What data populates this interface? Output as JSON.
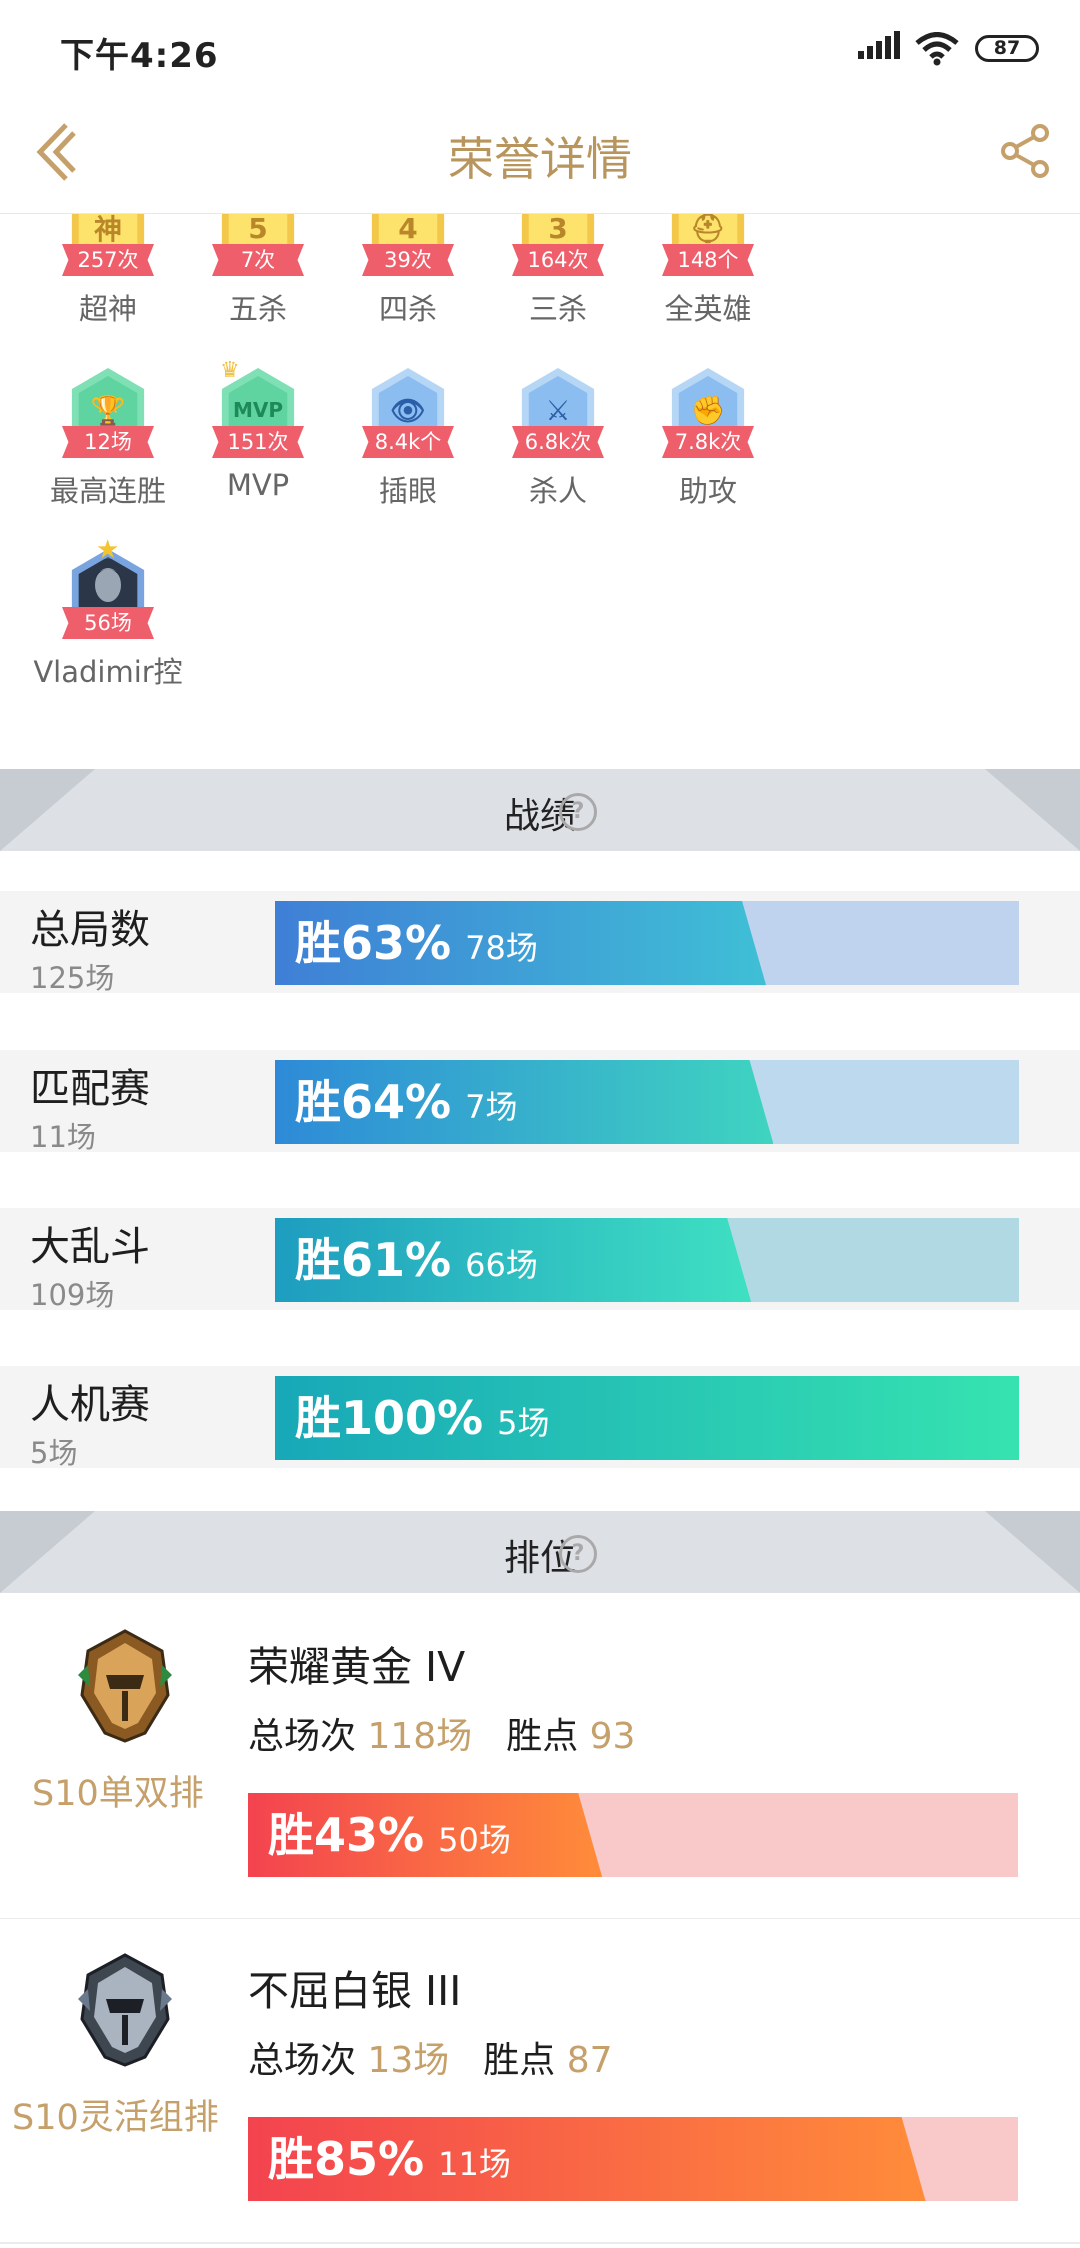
{
  "status_bar": {
    "time": "下午4:26",
    "battery": "87"
  },
  "header": {
    "title": "荣誉详情"
  },
  "honors": [
    {
      "count": "257次",
      "label": "超神",
      "glyph": "神",
      "theme": "gold"
    },
    {
      "count": "7次",
      "label": "五杀",
      "glyph": "5",
      "theme": "gold"
    },
    {
      "count": "39次",
      "label": "四杀",
      "glyph": "4",
      "theme": "gold"
    },
    {
      "count": "164次",
      "label": "三杀",
      "glyph": "3",
      "theme": "gold"
    },
    {
      "count": "148个",
      "label": "全英雄",
      "glyph": "⛑",
      "theme": "gold"
    },
    {
      "count": "12场",
      "label": "最高连胜",
      "glyph": "🏆",
      "theme": "green"
    },
    {
      "count": "151次",
      "label": "MVP",
      "glyph": "MVP",
      "theme": "green"
    },
    {
      "count": "8.4k个",
      "label": "插眼",
      "glyph": "👁",
      "theme": "blue"
    },
    {
      "count": "6.8k次",
      "label": "杀人",
      "glyph": "⚔",
      "theme": "blue"
    },
    {
      "count": "7.8k次",
      "label": "助攻",
      "glyph": "✊",
      "theme": "blue"
    },
    {
      "count": "56场",
      "label": "Vladimir控",
      "glyph": "",
      "theme": "hero"
    }
  ],
  "stats_section": {
    "title": "战绩",
    "help": "?"
  },
  "stats": [
    {
      "name": "总局数",
      "count": "125场",
      "win_text": "胜63%",
      "win_games": "78场",
      "win_rate": 0.63,
      "colors": [
        "#3f7fd6",
        "#3fbfd6"
      ],
      "track": "#bfd3ee"
    },
    {
      "name": "匹配赛",
      "count": "11场",
      "win_text": "胜64%",
      "win_games": "7场",
      "win_rate": 0.64,
      "colors": [
        "#2e8ad8",
        "#3fd4c0"
      ],
      "track": "#bcd9ee"
    },
    {
      "name": "大乱斗",
      "count": "109场",
      "win_text": "胜61%",
      "win_games": "66场",
      "win_rate": 0.61,
      "colors": [
        "#1e9dc0",
        "#3fe0c2"
      ],
      "track": "#b0d9e4"
    },
    {
      "name": "人机赛",
      "count": "5场",
      "win_text": "胜100%",
      "win_games": "5场",
      "win_rate": 1.0,
      "colors": [
        "#18a8b8",
        "#36e3b0"
      ],
      "track": "#b0e4dc"
    }
  ],
  "ranked_section": {
    "title": "排位",
    "help": "?"
  },
  "ranked": [
    {
      "queue": "S10单双排",
      "tier": "荣耀黄金 IV",
      "games_label": "总场次",
      "games": "118场",
      "lp_label": "胜点",
      "lp": "93",
      "win_text": "胜43%",
      "win_games": "50场",
      "win_rate": 0.43,
      "emblem": "gold"
    },
    {
      "queue": "S10灵活组排",
      "tier": "不屈白银 III",
      "games_label": "总场次",
      "games": "13场",
      "lp_label": "胜点",
      "lp": "87",
      "win_text": "胜85%",
      "win_games": "11场",
      "win_rate": 0.85,
      "emblem": "silver"
    }
  ]
}
